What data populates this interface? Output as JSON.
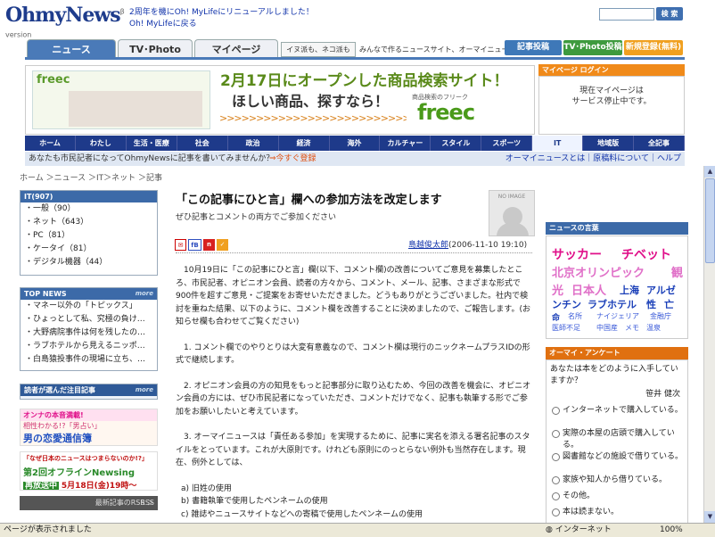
{
  "header": {
    "logo": "OhmyNews",
    "logo_version": "β version",
    "announce": [
      "2周年を機にOh! MyLifeにリニューアルしました！",
      "Oh! MyLifeに戻る"
    ],
    "search_btn": "検 索",
    "search_value": ""
  },
  "tabs": [
    {
      "label": "ニュース"
    },
    {
      "label": "TV･Photo"
    },
    {
      "label": "マイページ"
    }
  ],
  "slogan_box": "イヌ派も、ネコ派も",
  "slogan": "みんなで作るニュースサイト、オーマイニュース",
  "header_buttons": [
    "記事投稿",
    "TV･Photo投稿",
    "新規登録(無料)"
  ],
  "banner": {
    "freec_small": "freec",
    "head1": "2月17日にオープンした商品検索サイト！",
    "head2": "ほしい商品、探すなら！",
    "tag": "商品検索のフリーク",
    "logo": "freec"
  },
  "mypage": {
    "head": "マイページ ログイン",
    "text1": "現在マイページは",
    "text2": "サービス停止中です。"
  },
  "categories": [
    "ホーム",
    "わたし",
    "生活・医療",
    "社会",
    "政治",
    "経済",
    "海外",
    "カルチャー",
    "スタイル",
    "スポーツ",
    "IT",
    "地域版",
    "全記事"
  ],
  "subbar": {
    "left": "あなたも市民記者になってOhmyNewsに記事を書いてみませんか？",
    "register": "⇒今すぐ登録",
    "right": "オーマイニュースとは｜原稿料について｜ヘルプ"
  },
  "breadcrumb": "ホーム ＞ニュース ＞IT＞ネット ＞記事",
  "it_box": {
    "head": "IT(907)",
    "items": [
      "・一般（90）",
      "・ネット（643）",
      "・PC（81）",
      "・ケータイ（81）",
      "・デジタル機器（44）"
    ]
  },
  "topnews": {
    "head": "TOP NEWS",
    "more": "more",
    "items": [
      "・マネー以外の「トピックス」",
      "・ひょっとして私、究極の負け…",
      "・大野病院事件は何を残したの…",
      "・ラブホテルから見えるニッポ…",
      "・白島猿投事件の現場に立ち、…"
    ]
  },
  "picked": {
    "head": "読者が選んだ注目記事",
    "more": "more"
  },
  "ad1": {
    "l1": "オンナの本音満載!",
    "l2": "相性わかる!?「男占い」",
    "l3": "男の恋愛通信簿"
  },
  "ad2": {
    "l1": "「なぜ日本のニュースはつまらないのか!?」",
    "l2": "第2回オフラインNewsing",
    "l3": "再放送中",
    "l4": "5月18日(金)19時〜"
  },
  "rss": {
    "label": "RSS",
    "link": "最新記事のRSS ＞"
  },
  "article": {
    "title": "「この記事にひと言」欄への参加方法を改定します",
    "subtitle": "ぜひ記事とコメントの両方でご参加ください",
    "noimage": "NO IMAGE",
    "author": "島越俊太郎",
    "date": "(2006-11-10 19:10)",
    "icons": [
      "✉",
      "fB",
      "n"
    ]
  },
  "body": [
    "10月19日に「この記事にひと言」欄(以下、コメント欄)の改善についてご意見を募集したところ、市民記者、オピニオン会員、読者の方々から、コメント、メール、記事、さまざまな形式で900件を超すご意見・ご提案をお寄せいただきました。どうもありがとうございました。社内で検討を重ねた結果、以下のように、コメント欄を改善することに決めましたので、ご報告します。(お知らせ欄も合わせてご覧ください)",
    "1. コメント欄でのやりとりは大変有意義なので、コメント欄は現行のニックネームプラスIDの形式で継続します。",
    "2. オピニオン会員の方の知見をもっと記事部分に取り込むため、今回の改善を機会に、オピニオン会員の方には、ぜひ市民記者になっていただき、コメントだけでなく、記事も執筆する形でご参加をお願いしたいと考えています。",
    "3. オーマイニュースは「責任ある参加」を実現するために、記事に実名を添える署名記事のスタイルをとっています。これが大原則です。けれども原則にのっとらない例外も当然存在します。現在、例外としては、",
    "a) 旧姓の使用",
    "b) 書籍執筆で使用したペンネームの使用",
    "c) 雑誌やニュースサイトなどへの寄稿で使用したペンネームの使用"
  ],
  "keywords": {
    "head": "ニュースの言葉",
    "words": [
      {
        "t": "サッカー",
        "c": "#e0108a"
      },
      {
        "t": "チベット",
        "c": "#e0108a"
      },
      {
        "t": "北京オリンピック",
        "c": "#e070c8"
      },
      {
        "t": "観",
        "c": "#e070c8"
      },
      {
        "t": "光",
        "c": "#e070c8"
      },
      {
        "t": "日本人",
        "c": "#e070c8"
      },
      {
        "t": "上海",
        "c": "#1a3fb8"
      },
      {
        "t": "アルゼ",
        "c": "#1a3fb8"
      },
      {
        "t": "ンチン",
        "c": "#1a3fb8"
      },
      {
        "t": "ラブホテル",
        "c": "#1a3fb8"
      },
      {
        "t": "性",
        "c": "#1a3fb8"
      },
      {
        "t": "亡",
        "c": "#1a3fb8"
      },
      {
        "t": "命",
        "c": "#1a3fb8"
      },
      {
        "t": "名所",
        "c": "#3a5ad8"
      },
      {
        "t": "ナイジェリア",
        "c": "#3a5ad8"
      },
      {
        "t": "金融庁",
        "c": "#3a5ad8"
      },
      {
        "t": "医師不足",
        "c": "#3a5ad8"
      },
      {
        "t": "中国産",
        "c": "#3a5ad8"
      },
      {
        "t": "メモ",
        "c": "#3a5ad8"
      },
      {
        "t": "温泉",
        "c": "#3a5ad8"
      }
    ]
  },
  "enquete": {
    "head": "オーマイ・アンケート",
    "q": "あなたは本をどのように入手していますか？",
    "who": "笹井 健次",
    "options": [
      "インターネットで購入している。",
      "実際の本屋の店頭で購入している。",
      "図書館などの施設で借りている。",
      "家族や知人から借りている。",
      "その他。",
      "本は読まない。"
    ]
  },
  "status": {
    "left": "ページが表示されました",
    "zone": "インターネット",
    "zoom": "100%"
  }
}
